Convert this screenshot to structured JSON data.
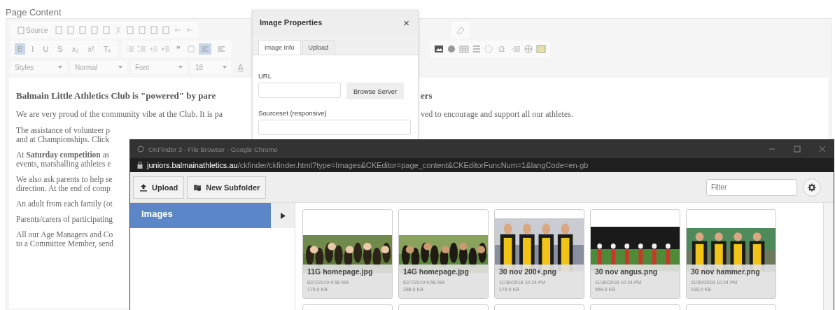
{
  "page_title": "Page Content",
  "toolbar": {
    "source_label": "Source",
    "formatting": [
      {
        "label": "B",
        "selected": true
      },
      {
        "label": "I",
        "selected": false
      },
      {
        "label": "U",
        "selected": false
      },
      {
        "label": "S",
        "selected": false
      },
      {
        "label": "x₂",
        "selected": false
      },
      {
        "label": "x²",
        "selected": false
      },
      {
        "label": "Tₓ",
        "selected": false
      }
    ],
    "quote": "❞",
    "alignment": [
      {
        "selected": true
      },
      {
        "selected": false
      }
    ],
    "special_char": "Ω",
    "dropdowns": [
      "Styles",
      "Normal",
      "Font",
      "18"
    ],
    "text_color": "A"
  },
  "editor": {
    "top_lines": [
      {
        "left": "Balmain Little Athletics Club is \"powered\" by pare",
        "right": "ers",
        "kind": "heading"
      },
      {
        "left": "We are very proud of the community vibe at the Club. It is pa",
        "right": "ved to encourage and support all our athletes.",
        "kind": "para"
      }
    ],
    "paragraphs": [
      [
        "The assistance of volunteer p",
        "and at Championships. Click"
      ],
      [
        "At **Saturday competition** as",
        "events, marshalling athletes e"
      ],
      [
        "We also ask parents to help se",
        "direction. At the end of comp"
      ],
      [
        "An adult from each family (ot"
      ],
      [
        "Parents/carers of participating"
      ],
      [
        "All our Age Managers and Co",
        "to a Committee Member, send"
      ]
    ]
  },
  "image_dialog": {
    "title": "Image Properties",
    "close": "×",
    "tabs": [
      {
        "label": "Image Info",
        "selected": true
      },
      {
        "label": "Upload",
        "selected": false
      }
    ],
    "url_label": "URL",
    "browse_button": "Browse Server",
    "sourceset_label": "Sourceset (responsive)"
  },
  "finder": {
    "window_title": "CKFinder 3 - File Browser - Google Chrome",
    "url_host": "juniors.balmainathletics.au",
    "url_path": "/ckfinder/ckfinder.html?type=Images&CKEditor=page_content&CKEditorFuncNum=1&langCode=en-gb",
    "buttons": [
      "Upload",
      "New Subfolder"
    ],
    "filter_placeholder": "Filter",
    "folders": [
      {
        "label": "Images",
        "selected": true
      }
    ],
    "files": [
      {
        "name": "11G homepage.jpg",
        "date": "8/27/2019 9:58 AM",
        "size": "179.0 KB"
      },
      {
        "name": "14G homepage.jpg",
        "date": "8/27/2019 9:58 AM",
        "size": "288.0 KB"
      },
      {
        "name": "30 nov 200+.png",
        "date": "11/30/2018 10:24 PM",
        "size": "179.0 KB"
      },
      {
        "name": "30 nov angus.png",
        "date": "11/30/2018 10:24 PM",
        "size": "959.0 KB"
      },
      {
        "name": "30 nov hammer.png",
        "date": "11/30/2018 10:24 PM",
        "size": "218.0 KB"
      }
    ]
  }
}
